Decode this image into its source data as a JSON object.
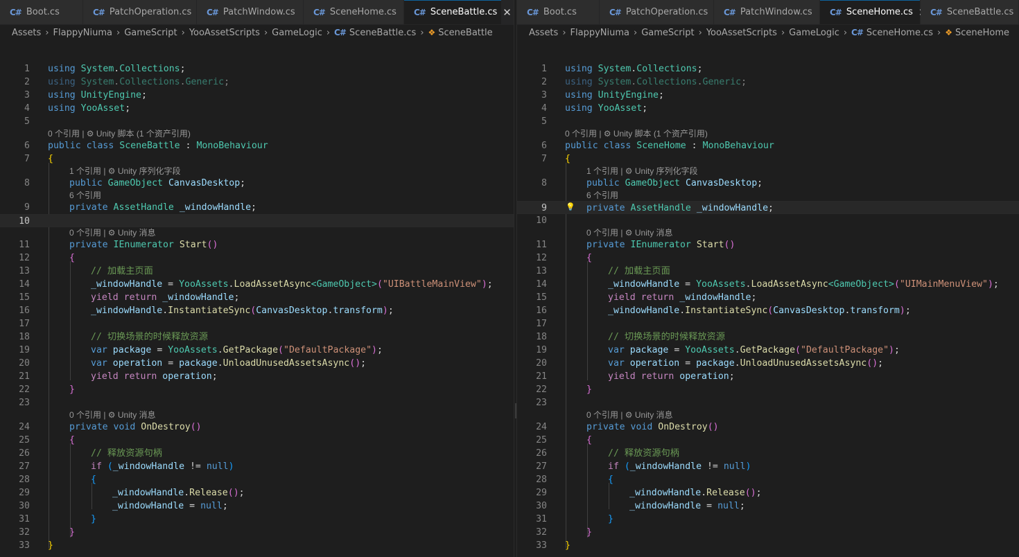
{
  "left_pane": {
    "tabs": [
      {
        "label": "Boot.cs",
        "active": false
      },
      {
        "label": "PatchOperation.cs",
        "active": false
      },
      {
        "label": "PatchWindow.cs",
        "active": false
      },
      {
        "label": "SceneHome.cs",
        "active": false
      },
      {
        "label": "SceneBattle.cs",
        "active": true
      }
    ],
    "breadcrumb": [
      "Assets",
      "FlappyNiuma",
      "GameScript",
      "YooAssetScripts",
      "GameLogic",
      "SceneBattle.cs",
      "SceneBattle"
    ],
    "codelens": {
      "class": "0 个引用 | ⚙ Unity 脚本 (1 个资产引用)",
      "field1": "1 个引用 | ⚙ Unity 序列化字段",
      "field2": "6 个引用",
      "start": "0 个引用 | ⚙ Unity 消息",
      "destroy": "0 个引用 | ⚙ Unity 消息"
    },
    "code": {
      "l1": "using System.Collections;",
      "l2": "using System.Collections.Generic;",
      "l3": "using UnityEngine;",
      "l4": "using YooAsset;",
      "l6": "public class SceneBattle : MonoBehaviour",
      "l7": "{",
      "l8": "public GameObject CanvasDesktop;",
      "l9": "private AssetHandle _windowHandle;",
      "l11": "private IEnumerator Start()",
      "l12": "{",
      "l13": "// 加载主页面",
      "l14": "_windowHandle = YooAssets.LoadAssetAsync<GameObject>(\"UIBattleMainView\");",
      "l15": "yield return _windowHandle;",
      "l16": "_windowHandle.InstantiateSync(CanvasDesktop.transform);",
      "l18": "// 切换场景的时候释放资源",
      "l19": "var package = YooAssets.GetPackage(\"DefaultPackage\");",
      "l20": "var operation = package.UnloadUnusedAssetsAsync();",
      "l21": "yield return operation;",
      "l22": "}",
      "l24": "private void OnDestroy()",
      "l25": "{",
      "l26": "// 释放资源句柄",
      "l27": "if (_windowHandle != null)",
      "l28": "{",
      "l29": "_windowHandle.Release();",
      "l30": "_windowHandle = null;",
      "l31": "}",
      "l32": "}",
      "l33": "}"
    },
    "current_line": 10
  },
  "right_pane": {
    "tabs": [
      {
        "label": "Boot.cs",
        "active": false
      },
      {
        "label": "PatchOperation.cs",
        "active": false
      },
      {
        "label": "PatchWindow.cs",
        "active": false
      },
      {
        "label": "SceneHome.cs",
        "active": true
      },
      {
        "label": "SceneBattle.cs",
        "active": false
      }
    ],
    "breadcrumb": [
      "Assets",
      "FlappyNiuma",
      "GameScript",
      "YooAssetScripts",
      "GameLogic",
      "SceneHome.cs",
      "SceneHome"
    ],
    "codelens": {
      "class": "0 个引用 | ⚙ Unity 脚本 (1 个资产引用)",
      "field1": "1 个引用 | ⚙ Unity 序列化字段",
      "field2": "6 个引用",
      "start": "0 个引用 | ⚙ Unity 消息",
      "destroy": "0 个引用 | ⚙ Unity 消息"
    },
    "code": {
      "l1": "using System.Collections;",
      "l2": "using System.Collections.Generic;",
      "l3": "using UnityEngine;",
      "l4": "using YooAsset;",
      "l6": "public class SceneHome : MonoBehaviour",
      "l7": "{",
      "l8": "public GameObject CanvasDesktop;",
      "l9": "private AssetHandle _windowHandle;",
      "l11": "private IEnumerator Start()",
      "l12": "{",
      "l13": "// 加载主页面",
      "l14": "_windowHandle = YooAssets.LoadAssetAsync<GameObject>(\"UIMainMenuView\");",
      "l15": "yield return _windowHandle;",
      "l16": "_windowHandle.InstantiateSync(CanvasDesktop.transform);",
      "l18": "// 切换场景的时候释放资源",
      "l19": "var package = YooAssets.GetPackage(\"DefaultPackage\");",
      "l20": "var operation = package.UnloadUnusedAssetsAsync();",
      "l21": "yield return operation;",
      "l22": "}",
      "l24": "private void OnDestroy()",
      "l25": "{",
      "l26": "// 释放资源句柄",
      "l27": "if (_windowHandle != null)",
      "l28": "{",
      "l29": "_windowHandle.Release();",
      "l30": "_windowHandle = null;",
      "l31": "}",
      "l32": "}",
      "l33": "}"
    },
    "current_line": 9
  },
  "icons": {
    "file": "csharp-file-icon",
    "symbol": "class-symbol-icon",
    "lightbulb": "lightbulb-icon",
    "close": "close-icon"
  },
  "colors": {
    "keyword": "#569cd6",
    "control": "#c586c0",
    "type": "#4ec9b0",
    "identifier": "#9cdcfe",
    "function": "#dcdcaa",
    "string": "#ce9178",
    "comment": "#6a9955",
    "accent": "#0e639c"
  }
}
